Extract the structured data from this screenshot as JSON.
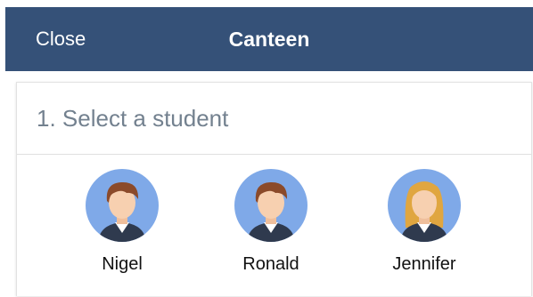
{
  "header": {
    "close_label": "Close",
    "title": "Canteen"
  },
  "section": {
    "title": "1. Select a student"
  },
  "students": [
    {
      "name": "Nigel",
      "avatar": "boy-avatar-icon"
    },
    {
      "name": "Ronald",
      "avatar": "boy-avatar-icon"
    },
    {
      "name": "Jennifer",
      "avatar": "girl-avatar-icon"
    }
  ],
  "colors": {
    "topbar": "#355178",
    "avatar_bg": "#7fa9e8",
    "boy_hair": "#8b4a2a",
    "girl_hair": "#e0a640",
    "skin": "#f7d0b0",
    "shirt": "#2f3a4e"
  }
}
